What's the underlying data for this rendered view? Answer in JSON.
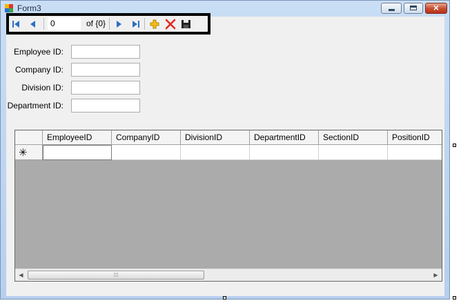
{
  "window": {
    "title": "Form3"
  },
  "navigator": {
    "position_value": "0",
    "count_text": "of {0}"
  },
  "fields": [
    {
      "label": "Employee ID:",
      "value": ""
    },
    {
      "label": "Company ID:",
      "value": ""
    },
    {
      "label": "Division ID:",
      "value": ""
    },
    {
      "label": "Department ID:",
      "value": ""
    }
  ],
  "grid": {
    "columns": [
      "EmployeeID",
      "CompanyID",
      "DivisionID",
      "DepartmentID",
      "SectionID",
      "PositionID"
    ],
    "new_row_marker": "✳"
  },
  "icons": {
    "move_first": "move-first-icon",
    "move_previous": "move-previous-icon",
    "move_next": "move-next-icon",
    "move_last": "move-last-icon",
    "add_new": "add-new-icon",
    "delete": "delete-icon",
    "save": "save-icon"
  }
}
